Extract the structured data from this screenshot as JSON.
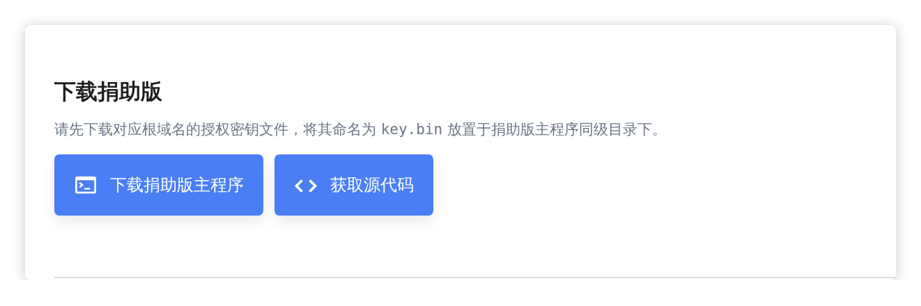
{
  "card": {
    "title": "下载捐助版",
    "description": {
      "before": "请先下载对应根域名的授权密钥文件，将其命名为 ",
      "code": "key.bin",
      "after": " 放置于捐助版主程序同级目录下。"
    },
    "buttons": [
      {
        "label": "下载捐助版主程序",
        "kind": "terminal"
      },
      {
        "label": "获取源代码",
        "kind": "code"
      }
    ]
  }
}
